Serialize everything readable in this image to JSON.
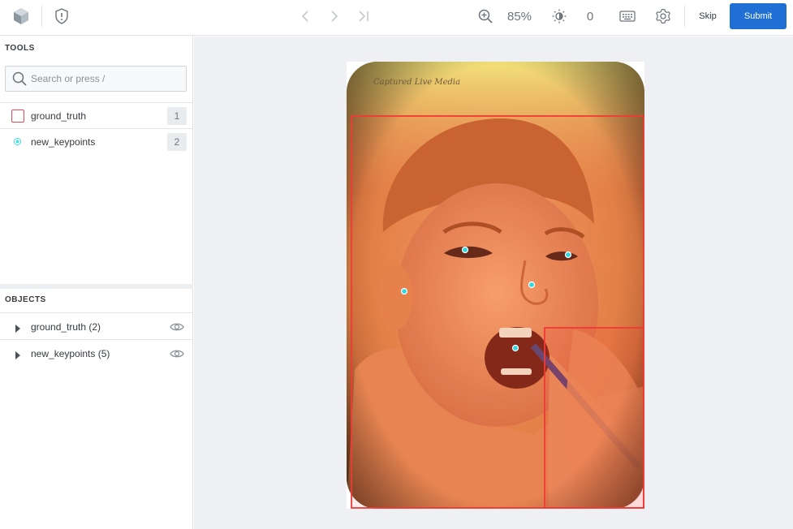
{
  "header": {
    "logo_icon": "cube-logo-icon",
    "issue_icon": "shield-alert-icon",
    "nav_icons": [
      "chevron-left-icon",
      "chevron-right-icon",
      "skip-to-end-icon"
    ],
    "zoom_label": "85%",
    "brightness_value": "0",
    "skip_label": "Skip",
    "submit_label": "Submit",
    "accent_color": "#1f6fd4"
  },
  "tools": {
    "title": "TOOLS",
    "search_placeholder": "Search or press /",
    "items": [
      {
        "label": "ground_truth",
        "hotkey": "1",
        "icon": "bounding-box-icon",
        "color": "#e8485a"
      },
      {
        "label": "new_keypoints",
        "hotkey": "2",
        "icon": "keypoint-icon",
        "color": "#3de0e0"
      }
    ]
  },
  "objects": {
    "title": "OBJECTS",
    "items": [
      {
        "label": "ground_truth (2)"
      },
      {
        "label": "new_keypoints (5)"
      }
    ]
  },
  "canvas": {
    "watermark": "Captured Live Media",
    "box_color": "#f03a36",
    "keypoint_color": "#2fd7e0",
    "bounding_boxes": 2,
    "keypoints": 5
  }
}
